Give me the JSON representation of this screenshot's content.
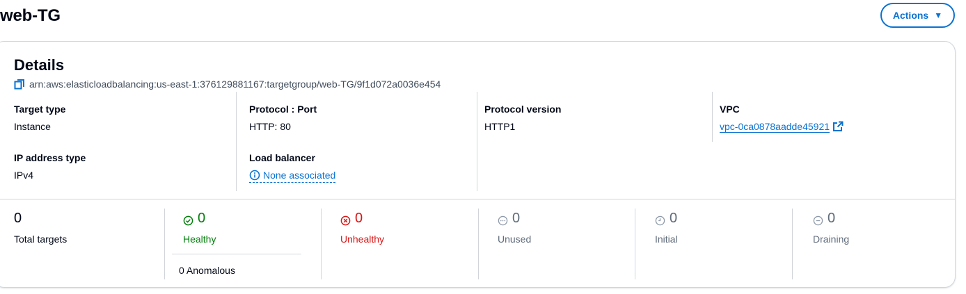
{
  "page": {
    "title": "web-TG"
  },
  "actions": {
    "label": "Actions"
  },
  "details": {
    "title": "Details",
    "arn": "arn:aws:elasticloadbalancing:us-east-1:376129881167:targetgroup/web-TG/9f1d072a0036e454",
    "fields": {
      "target_type": {
        "label": "Target type",
        "value": "Instance"
      },
      "protocol_port": {
        "label": "Protocol : Port",
        "value": "HTTP: 80"
      },
      "protocol_version": {
        "label": "Protocol version",
        "value": "HTTP1"
      },
      "vpc": {
        "label": "VPC",
        "value": "vpc-0ca0878aadde45921"
      },
      "ip_address_type": {
        "label": "IP address type",
        "value": "IPv4"
      },
      "load_balancer": {
        "label": "Load balancer",
        "value": "None associated"
      }
    }
  },
  "stats": {
    "total": {
      "count": "0",
      "label": "Total targets"
    },
    "healthy": {
      "count": "0",
      "label": "Healthy",
      "icon": "check-circle-icon"
    },
    "anomalous": "0 Anomalous",
    "unhealthy": {
      "count": "0",
      "label": "Unhealthy",
      "icon": "x-circle-icon"
    },
    "unused": {
      "count": "0",
      "label": "Unused",
      "icon": "ellipsis-circle-icon"
    },
    "initial": {
      "count": "0",
      "label": "Initial",
      "icon": "clock-icon"
    },
    "draining": {
      "count": "0",
      "label": "Draining",
      "icon": "minus-circle-icon"
    }
  },
  "colors": {
    "accent": "#0972d3",
    "success": "#037f0c",
    "error": "#d91515",
    "muted": "#5f6b7a",
    "border": "#d1d5db"
  }
}
